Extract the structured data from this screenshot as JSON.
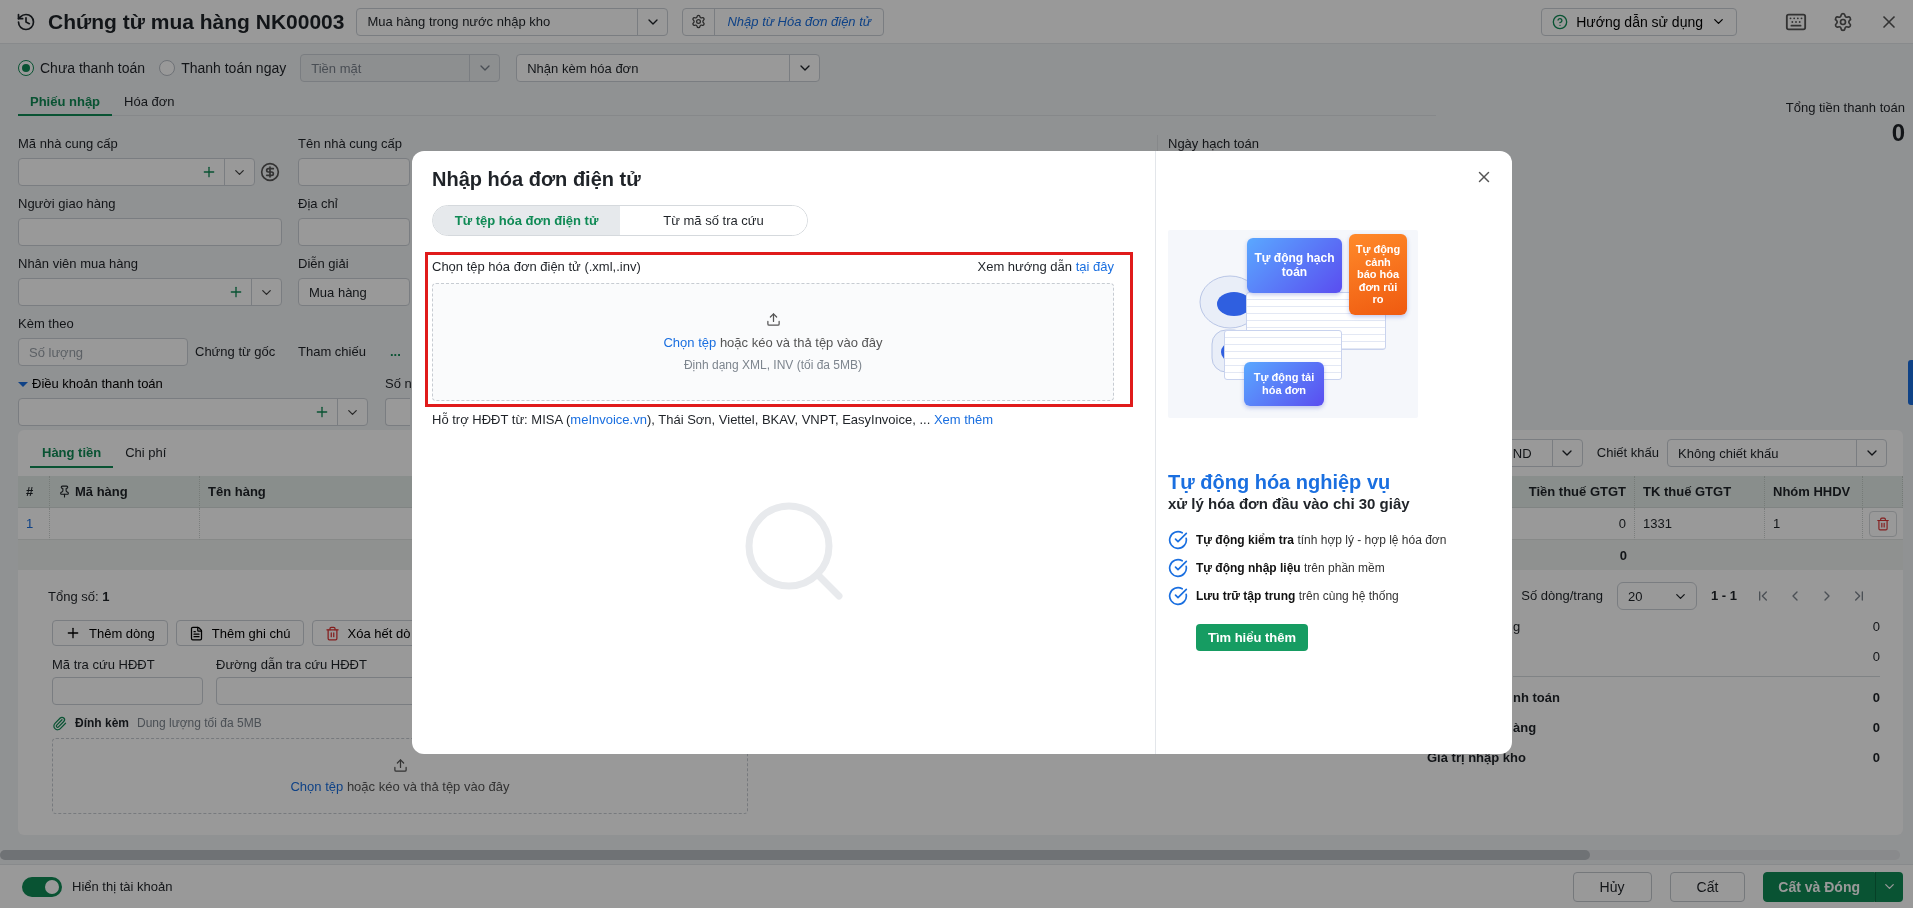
{
  "header": {
    "title": "Chứng từ mua hàng NK00003",
    "voucher_type": "Mua hàng trong nước nhập kho",
    "import_link": "Nhập từ Hóa đơn điện tử",
    "help": "Hướng dẫn sử dụng"
  },
  "payment": {
    "options": [
      {
        "label": "Chưa thanh toán",
        "selected": true
      },
      {
        "label": "Thanh toán ngay",
        "selected": false
      }
    ],
    "method": {
      "value": "Tiền mặt",
      "disabled": true
    },
    "invoice_option": "Nhận kèm hóa đơn"
  },
  "tabs": [
    {
      "label": "Phiếu nhập",
      "selected": true
    },
    {
      "label": "Hóa đơn",
      "selected": false
    }
  ],
  "form": {
    "supplier_code": {
      "label": "Mã nhà cung cấp"
    },
    "supplier_name": {
      "label": "Tên nhà cung cấp"
    },
    "deliverer": {
      "label": "Người giao hàng"
    },
    "address": {
      "label": "Địa chỉ"
    },
    "buyer": {
      "label": "Nhân viên mua hàng"
    },
    "description": {
      "label": "Diễn giải",
      "value": "Mua hàng"
    },
    "attached": {
      "label": "Kèm theo",
      "placeholder": "Số lượng",
      "unit": "Chứng từ gốc"
    },
    "reference": {
      "label": "Tham chiếu",
      "action": "..."
    },
    "payment_terms": {
      "label": "Điều khoản thanh toán",
      "expanded": true
    },
    "cut_label": "Số n",
    "posting_date": {
      "label": "Ngày hạch toán"
    }
  },
  "total_payment": {
    "label": "Tổng tiền thanh toán",
    "value": "0"
  },
  "detail": {
    "tabs": [
      {
        "label": "Hàng tiền",
        "selected": true
      },
      {
        "label": "Chi phí",
        "selected": false
      }
    ],
    "currency": "ND",
    "discount": {
      "label": "Chiết khấu",
      "value": "Không chiết khấu"
    },
    "columns": [
      {
        "label": "#"
      },
      {
        "label": "Mã hàng",
        "pinned": true
      },
      {
        "label": "Tên hàng"
      },
      {
        "label": "Tiền thuế GTGT"
      },
      {
        "label": "TK thuế GTGT"
      },
      {
        "label": "Nhóm HHDV"
      }
    ],
    "rows": [
      {
        "index": "1",
        "vat_amount": "0",
        "vat_account": "1331",
        "goods_group": "1"
      }
    ],
    "totals": {
      "vat_amount": "0"
    },
    "count": {
      "label": "Tổng số:",
      "value": "1"
    },
    "page_size": {
      "label": "Số dòng/trang",
      "value": "20"
    },
    "range": "1 - 1",
    "actions": [
      {
        "kind": "add",
        "label": "Thêm dòng"
      },
      {
        "kind": "note",
        "label": "Thêm ghi chú"
      },
      {
        "kind": "delete",
        "label": "Xóa hết dò"
      }
    ],
    "lookup_code": {
      "label": "Mã tra cứu HĐĐT"
    },
    "lookup_url": {
      "label": "Đường dẫn tra cứu HĐĐT"
    },
    "attachment": {
      "label": "Đính kèm",
      "hint": "Dung lượng tối đa 5MB",
      "link": "Chọn tệp",
      "text": "hoặc kéo và thả tệp vào đây"
    }
  },
  "summary": [
    {
      "kind": "line",
      "label": "g",
      "value": "0"
    },
    {
      "kind": "line",
      "value": "0"
    },
    {
      "kind": "total",
      "label": "nh toán",
      "value": "0"
    },
    {
      "kind": "total",
      "label": "àng",
      "value": "0"
    },
    {
      "kind": "grand_total",
      "label": "Giá trị nhập kho",
      "value": "0"
    }
  ],
  "footer": {
    "show_accounts": {
      "label": "Hiển thị tài khoản",
      "on": true
    },
    "buttons": [
      {
        "kind": "secondary",
        "label": "Hủy"
      },
      {
        "kind": "secondary",
        "label": "Cất"
      },
      {
        "kind": "primary",
        "label": "Cất và Đóng"
      }
    ]
  },
  "dialog": {
    "title": "Nhập hóa đơn điện tử",
    "modes": [
      {
        "label": "Từ tệp hóa đơn điện tử",
        "selected": true
      },
      {
        "label": "Từ mã số tra cứu",
        "selected": false
      }
    ],
    "file_label": "Chọn tệp hóa đơn điện tử (.xml,.inv)",
    "guide": {
      "text": "Xem hướng dẫn",
      "link": "tại đây"
    },
    "dropzone": {
      "link": "Chọn tệp",
      "text": "hoặc kéo và thả tệp vào đây",
      "hint": "Định dạng XML, INV (tối đa 5MB)"
    },
    "support": {
      "prefix": "Hỗ trợ HĐĐT từ: MISA (",
      "link": "meInvoice.vn",
      "suffix": "), Thái Sơn, Viettel, BKAV, VNPT, EasyInvoice, ...",
      "more": "Xem thêm"
    },
    "promo": {
      "cards": [
        "Tự động hạch toán",
        "Tự động cảnh báo hóa đơn rủi ro",
        "Tự động tải hóa đơn"
      ],
      "heading": "Tự động hóa nghiệp vụ",
      "subheading": "xử lý hóa đơn đầu vào chỉ 30 giây",
      "features": [
        "**Tự động kiểm tra** tính hợp lý - hợp lệ hóa đơn",
        "**Tự động nhập liệu** trên phần mềm",
        "**Lưu trữ tập trung** trên cùng hệ thống"
      ],
      "button": "Tìm hiểu thêm"
    }
  }
}
